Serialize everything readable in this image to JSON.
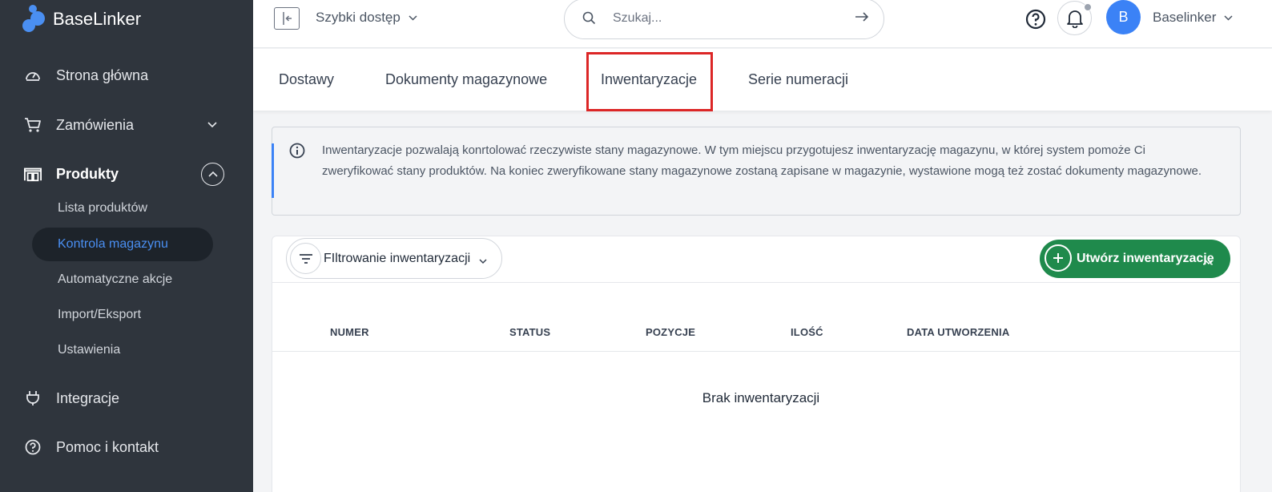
{
  "app": {
    "logo_text": "BaseLinker"
  },
  "sidebar": {
    "items": [
      {
        "label": "Strona główna",
        "icon": "dashboard-icon"
      },
      {
        "label": "Zamówienia",
        "icon": "cart-icon"
      },
      {
        "label": "Produkty",
        "icon": "warehouse-icon"
      },
      {
        "label": "Integracje",
        "icon": "plug-icon"
      },
      {
        "label": "Pomoc i kontakt",
        "icon": "help-icon"
      }
    ],
    "sub_items": [
      {
        "label": "Lista produktów"
      },
      {
        "label": "Kontrola magazynu"
      },
      {
        "label": "Automatyczne akcje"
      },
      {
        "label": "Import/Eksport"
      },
      {
        "label": "Ustawienia"
      }
    ]
  },
  "topbar": {
    "quick_access": "Szybki dostęp",
    "search_placeholder": "Szukaj...",
    "avatar_letter": "B",
    "user_name": "Baselinker"
  },
  "tabs": [
    {
      "label": "Dostawy"
    },
    {
      "label": "Dokumenty magazynowe"
    },
    {
      "label": "Inwentaryzacje"
    },
    {
      "label": "Serie numeracji"
    }
  ],
  "info": {
    "text": "Inwentaryzacje pozwalają konrtolować rzeczywiste stany magazynowe. W tym miejscu przygotujesz inwentaryzację magazynu, w której system pomoże Ci zweryfikować stany produktów. Na koniec zweryfikowane stany magazynowe zostaną zapisane w magazynie, wystawione mogą też zostać dokumenty magazynowe."
  },
  "card": {
    "filter_label": "FIltrowanie inwentaryzacji",
    "create_label": "Utwórz inwentaryzację",
    "columns": [
      "NUMER",
      "STATUS",
      "POZYCJE",
      "ILOŚĆ",
      "DATA UTWORZENIA"
    ],
    "empty_text": "Brak inwentaryzacji"
  },
  "colors": {
    "sidebar_bg": "#2f353d",
    "accent_blue": "#3b82f6",
    "create_green": "#1f8a4c",
    "highlight_red": "#dc2626"
  }
}
